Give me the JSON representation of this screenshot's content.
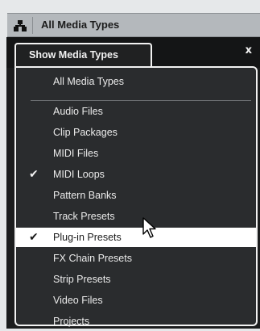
{
  "toolbar": {
    "title": "All Media Types",
    "icon": "filter-icon"
  },
  "panel": {
    "tab_label": "Show Media Types",
    "close_label": "x"
  },
  "menu": {
    "items": [
      {
        "label": "All Media Types",
        "checked": false
      },
      {
        "label": "Audio Files",
        "checked": false
      },
      {
        "label": "Clip Packages",
        "checked": false
      },
      {
        "label": "MIDI Files",
        "checked": false
      },
      {
        "label": "MIDI Loops",
        "checked": true
      },
      {
        "label": "Pattern Banks",
        "checked": false
      },
      {
        "label": "Track Presets",
        "checked": false
      },
      {
        "label": "Plug-in Presets",
        "checked": true,
        "highlighted": true
      },
      {
        "label": "FX Chain Presets",
        "checked": false
      },
      {
        "label": "Strip Presets",
        "checked": false
      },
      {
        "label": "Video Files",
        "checked": false
      },
      {
        "label": "Projects",
        "checked": false
      }
    ],
    "check_glyph": "✔"
  },
  "colors": {
    "highlight": "#ffffff",
    "panel_bg": "#2a2c2e",
    "toolbar_bg": "#b4b8bc"
  }
}
